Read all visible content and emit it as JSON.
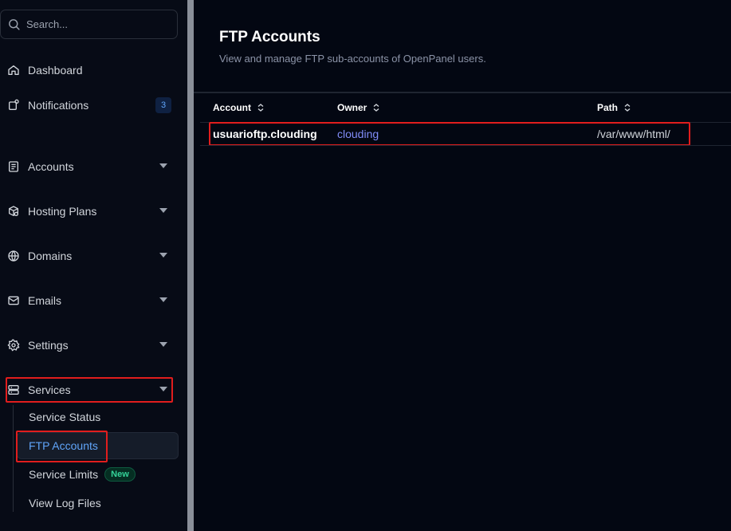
{
  "search": {
    "placeholder": "Search..."
  },
  "sidebar": {
    "top_items": [
      {
        "label": "Dashboard",
        "icon": "home-icon"
      },
      {
        "label": "Notifications",
        "icon": "bell-icon",
        "badge": "3"
      }
    ],
    "groups": [
      {
        "label": "Accounts",
        "icon": "accounts-icon"
      },
      {
        "label": "Hosting Plans",
        "icon": "hosting-plans-icon"
      },
      {
        "label": "Domains",
        "icon": "www-globe-icon"
      },
      {
        "label": "Emails",
        "icon": "mail-icon"
      },
      {
        "label": "Settings",
        "icon": "gear-icon"
      },
      {
        "label": "Services",
        "icon": "server-icon"
      }
    ],
    "services_sub": [
      {
        "label": "Service Status"
      },
      {
        "label": "FTP Accounts",
        "active": true
      },
      {
        "label": "Service Limits",
        "badge": "New"
      },
      {
        "label": "View Log Files"
      }
    ]
  },
  "main": {
    "title": "FTP Accounts",
    "subtitle": "View and manage FTP sub-accounts of OpenPanel users.",
    "columns": [
      "Account",
      "Owner",
      "Path"
    ],
    "rows": [
      {
        "account": "usuarioftp.clouding",
        "owner": "clouding",
        "path": "/var/www/html/"
      }
    ]
  },
  "colors": {
    "accent": "#3b82f6",
    "owner_link": "#818cf8",
    "highlight": "#e11d1d",
    "new_badge": "#34d399"
  }
}
